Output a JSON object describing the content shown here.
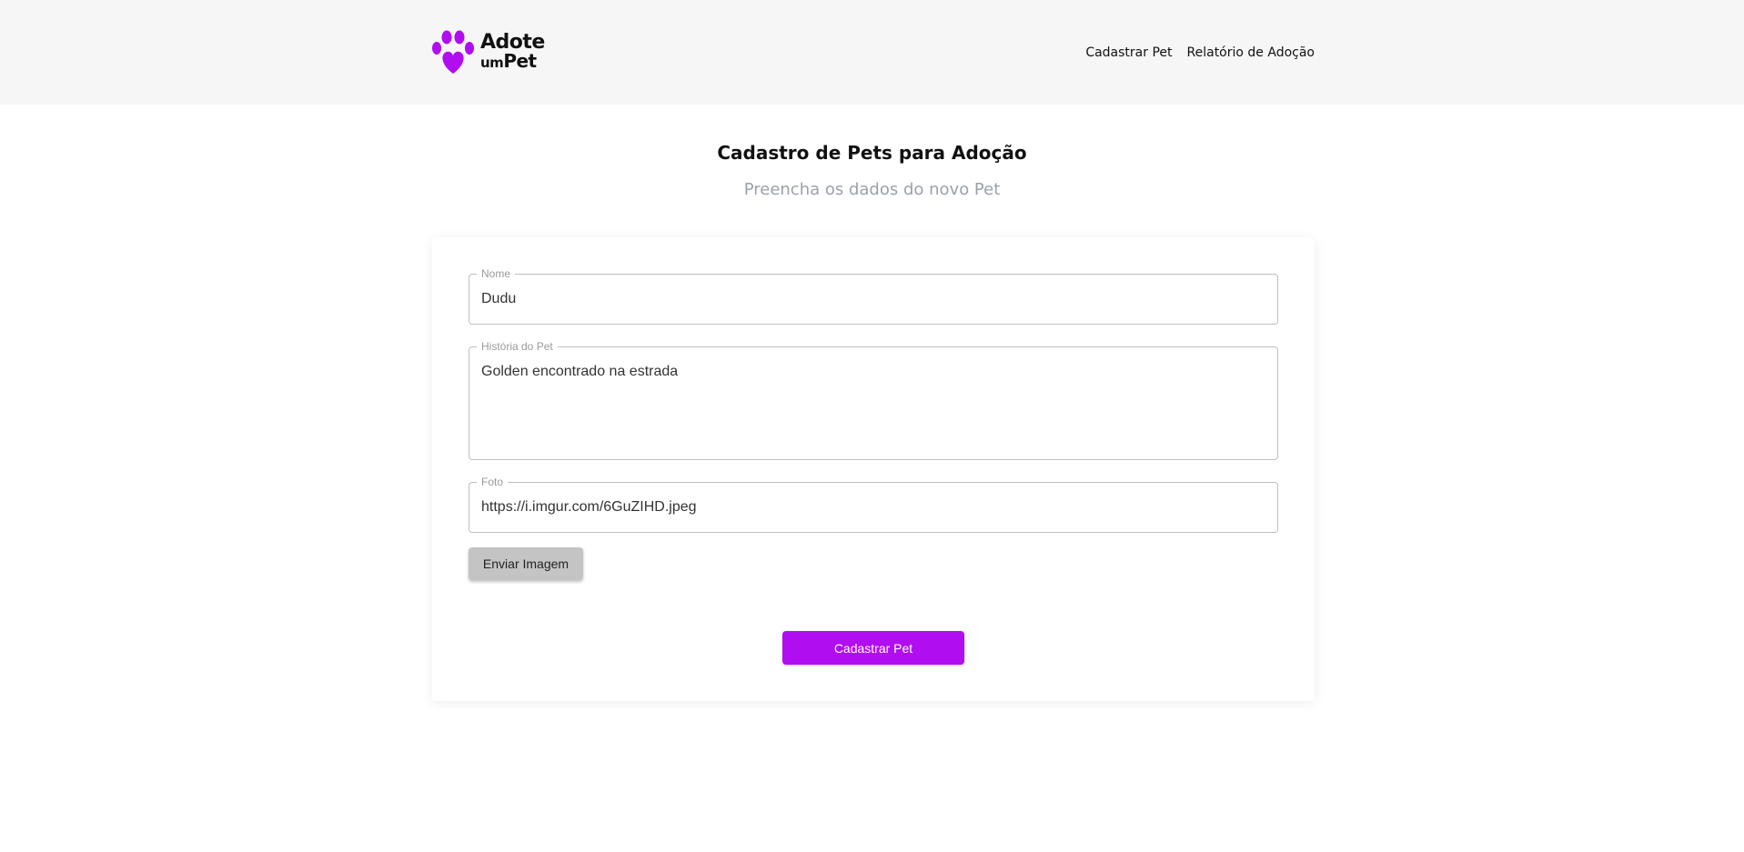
{
  "brand": {
    "logo_line1": "Adote",
    "logo_line2_small": "um",
    "logo_line2_big": "Pet",
    "accent_color": "#b00ef0",
    "logo_icon": "paw-heart-icon"
  },
  "nav": {
    "items": [
      {
        "label": "Cadastrar Pet"
      },
      {
        "label": "Relatório de Adoção"
      }
    ]
  },
  "page": {
    "title": "Cadastro de Pets para Adoção",
    "subtitle": "Preencha os dados do novo Pet"
  },
  "form": {
    "nome": {
      "label": "Nome",
      "value": "Dudu"
    },
    "historia": {
      "label": "História do Pet",
      "value": "Golden encontrado na estrada"
    },
    "foto": {
      "label": "Foto",
      "value": "https://i.imgur.com/6GuZIHD.jpeg"
    },
    "upload_button": "Enviar Imagem",
    "submit_button": "Cadastrar Pet"
  }
}
